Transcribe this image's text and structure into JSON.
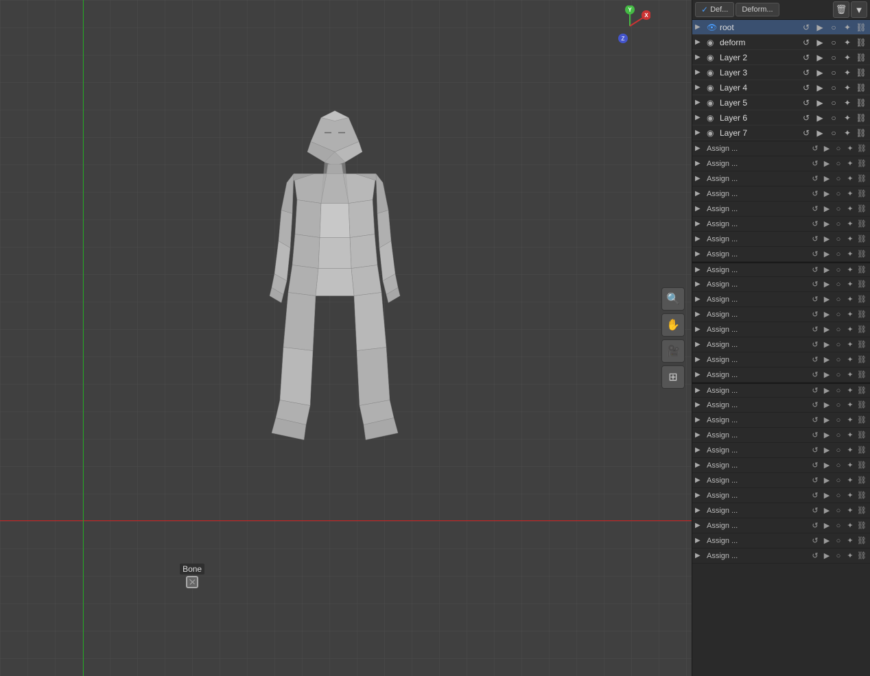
{
  "header": {
    "def_label": "Def...",
    "deform_label": "Deform...",
    "delete_icon": "🗑",
    "filter_icon": "▼"
  },
  "bone_groups": [
    {
      "name": "root",
      "active": true,
      "eye": true
    },
    {
      "name": "deform",
      "active": false,
      "eye": false
    },
    {
      "name": "Layer 2",
      "active": false,
      "eye": false
    },
    {
      "name": "Layer 3",
      "active": false,
      "eye": false
    },
    {
      "name": "Layer 4",
      "active": false,
      "eye": false
    },
    {
      "name": "Layer 5",
      "active": false,
      "eye": false
    },
    {
      "name": "Layer 6",
      "active": false,
      "eye": false
    },
    {
      "name": "Layer 7",
      "active": false,
      "eye": false
    }
  ],
  "assign_rows": [
    {
      "name": "Assign ...",
      "group": 1
    },
    {
      "name": "Assign ...",
      "group": 1
    },
    {
      "name": "Assign ...",
      "group": 1
    },
    {
      "name": "Assign ...",
      "group": 1
    },
    {
      "name": "Assign ...",
      "group": 1
    },
    {
      "name": "Assign ...",
      "group": 1
    },
    {
      "name": "Assign ...",
      "group": 1
    },
    {
      "name": "Assign ...",
      "group": 1
    },
    {
      "name": "Assign ...",
      "group": 2
    },
    {
      "name": "Assign ...",
      "group": 2
    },
    {
      "name": "Assign ...",
      "group": 2
    },
    {
      "name": "Assign ...",
      "group": 2
    },
    {
      "name": "Assign ...",
      "group": 2
    },
    {
      "name": "Assign ...",
      "group": 2
    },
    {
      "name": "Assign ...",
      "group": 2
    },
    {
      "name": "Assign ...",
      "group": 2
    },
    {
      "name": "Assign ...",
      "group": 3
    },
    {
      "name": "Assign ...",
      "group": 3
    },
    {
      "name": "Assign ...",
      "group": 3
    },
    {
      "name": "Assign ...",
      "group": 3
    },
    {
      "name": "Assign ...",
      "group": 3
    },
    {
      "name": "Assign ...",
      "group": 3
    },
    {
      "name": "Assign ...",
      "group": 3
    },
    {
      "name": "Assign ...",
      "group": 3
    },
    {
      "name": "Assign ...",
      "group": 3
    },
    {
      "name": "Assign ...",
      "group": 3
    },
    {
      "name": "Assign ...",
      "group": 3
    },
    {
      "name": "Assign ...",
      "group": 3
    }
  ],
  "tools": [
    {
      "name": "zoom",
      "icon": "🔍"
    },
    {
      "name": "pan",
      "icon": "✋"
    },
    {
      "name": "camera",
      "icon": "🎥"
    },
    {
      "name": "grid",
      "icon": "⊞"
    }
  ],
  "bone_label": "Bone",
  "viewport_bg": "#3d3d3d"
}
